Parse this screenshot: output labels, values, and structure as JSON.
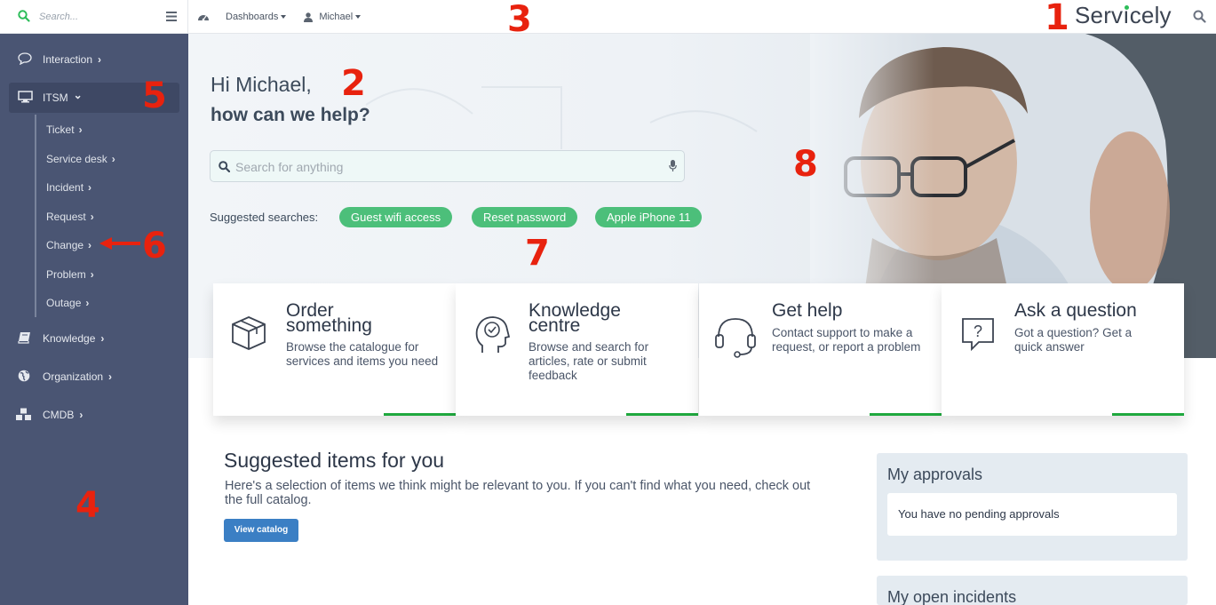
{
  "topbar": {
    "search_placeholder": "Search...",
    "dashboards_label": "Dashboards",
    "user_label": "Michael",
    "brand": {
      "part1": "Serv",
      "part2": "ı",
      "part3": "cely"
    }
  },
  "sidebar": {
    "items": [
      {
        "label": "Interaction",
        "icon": "chat-bubble-icon"
      },
      {
        "label": "ITSM",
        "icon": "monitor-icon"
      },
      {
        "label": "Knowledge",
        "icon": "book-icon"
      },
      {
        "label": "Organization",
        "icon": "globe-icon"
      },
      {
        "label": "CMDB",
        "icon": "cubes-icon"
      }
    ],
    "itsm_sub": [
      "Ticket",
      "Service desk",
      "Incident",
      "Request",
      "Change",
      "Problem",
      "Outage"
    ],
    "chevron_right": "›",
    "chevron_down": "⌄"
  },
  "hero": {
    "greeting": "Hi Michael,",
    "headline": "how can we help?",
    "search_placeholder": "Search for anything",
    "suggested_label": "Suggested searches:",
    "chips": [
      "Guest wifi access",
      "Reset password",
      "Apple iPhone 11"
    ]
  },
  "cards": [
    {
      "title_line1": "Order",
      "title_line2": "something",
      "desc": "Browse the catalogue for services and items you need",
      "icon": "box-icon"
    },
    {
      "title_line1": "Knowledge",
      "title_line2": "centre",
      "desc": "Browse and search for articles, rate or submit feedback",
      "icon": "head-check-icon"
    },
    {
      "title_line1": "Get help",
      "title_line2": "",
      "desc": "Contact support to make a request, or report a problem",
      "icon": "headset-icon"
    },
    {
      "title_line1": "Ask a question",
      "title_line2": "",
      "desc": "Got a question? Get a quick answer",
      "icon": "question-bubble-icon"
    }
  ],
  "suggested": {
    "title": "Suggested items for you",
    "desc": "Here's a selection of items we think might be relevant to you. If you can't find what you need, check out the full catalog.",
    "button": "View catalog"
  },
  "approvals": {
    "title": "My approvals",
    "empty": "You have no pending approvals"
  },
  "incidents": {
    "title": "My open incidents"
  },
  "annotations": [
    "1",
    "2",
    "3",
    "4",
    "5",
    "6",
    "7",
    "8"
  ],
  "colors": {
    "sidebar": "#4a5573",
    "accent_green": "#4cbf7a",
    "annotation_red": "#e8220e",
    "button_blue": "#3b7fc4"
  }
}
